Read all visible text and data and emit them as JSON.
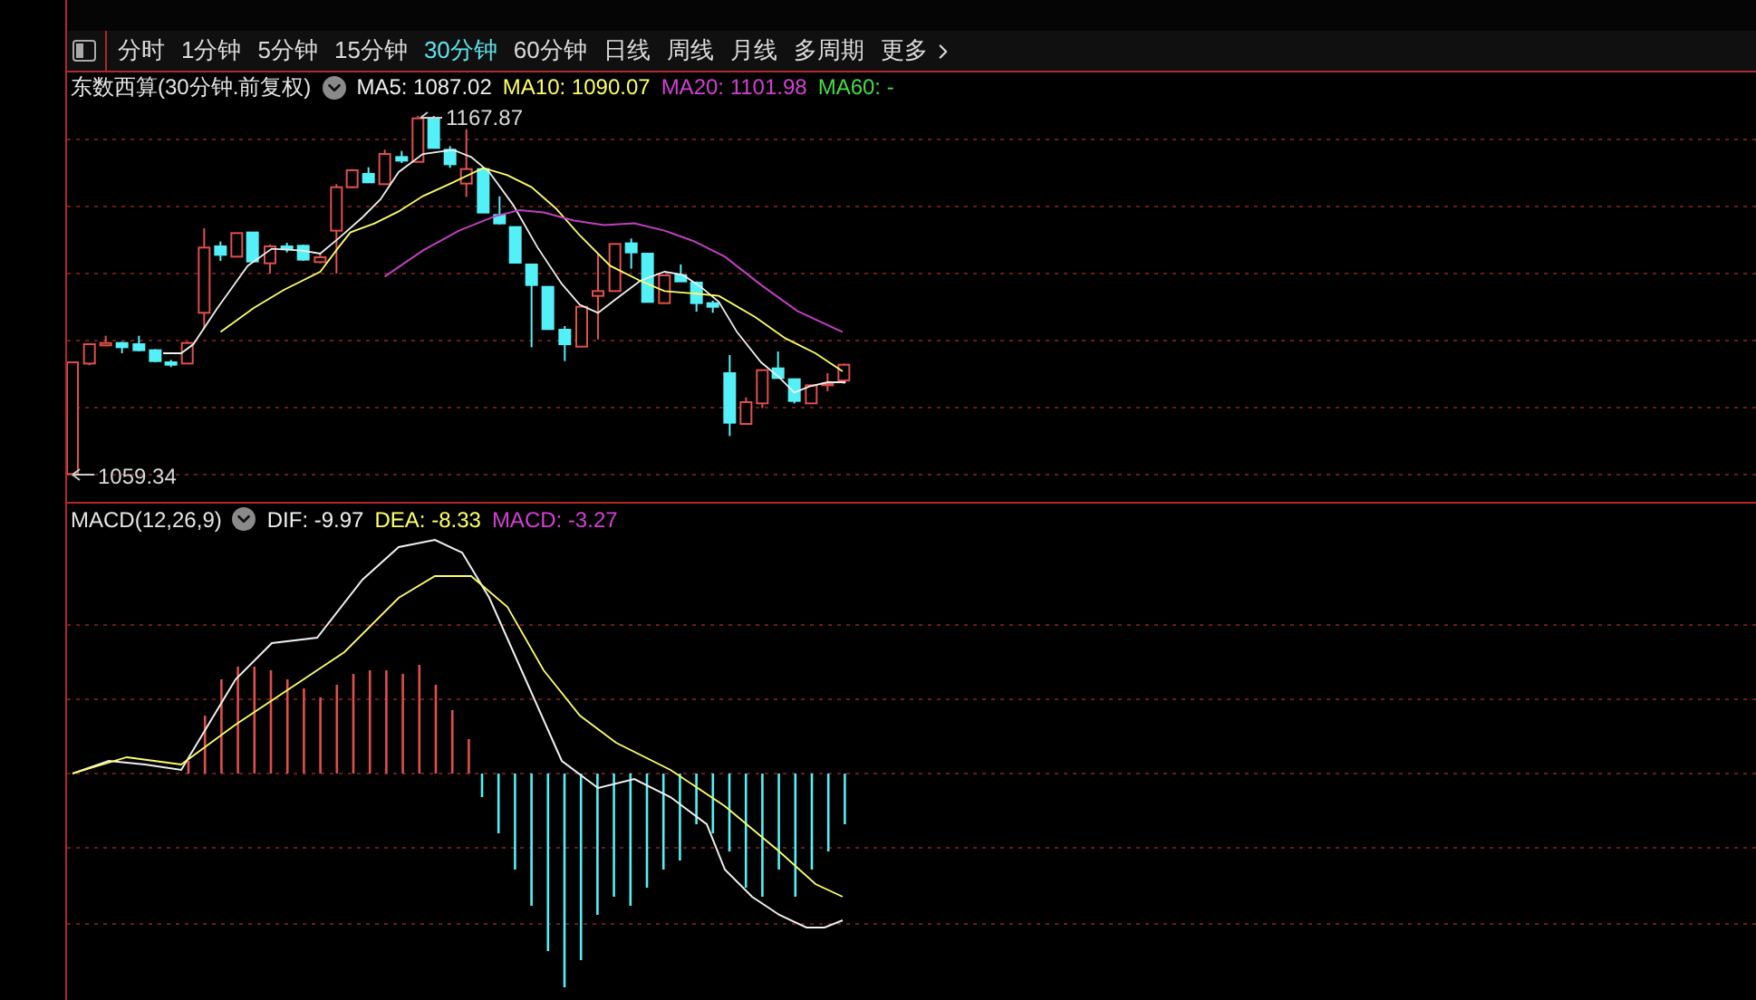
{
  "toolbar": {
    "tabs": [
      {
        "label": "分时",
        "selected": false
      },
      {
        "label": "1分钟",
        "selected": false
      },
      {
        "label": "5分钟",
        "selected": false
      },
      {
        "label": "15分钟",
        "selected": false
      },
      {
        "label": "30分钟",
        "selected": true
      },
      {
        "label": "60分钟",
        "selected": false
      },
      {
        "label": "日线",
        "selected": false
      },
      {
        "label": "周线",
        "selected": false
      },
      {
        "label": "月线",
        "selected": false
      },
      {
        "label": "多周期",
        "selected": false
      }
    ],
    "more": "更多"
  },
  "price_panel": {
    "title": "东数西算(30分钟.前复权)",
    "indicators": [
      {
        "text": "MA5: 1087.02",
        "color": "#f0f0f0"
      },
      {
        "text": "MA10: 1090.07",
        "color": "#ffff66"
      },
      {
        "text": "MA20: 1101.98",
        "color": "#d440d4"
      },
      {
        "text": "MA60: -",
        "color": "#44dd44"
      }
    ],
    "high_label": "1167.87",
    "low_label": "1059.34"
  },
  "macd_panel": {
    "title": "MACD(12,26,9)",
    "indicators": [
      {
        "text": "DIF: -9.97",
        "color": "#f0f0f0"
      },
      {
        "text": "DEA: -8.33",
        "color": "#ffff66"
      },
      {
        "text": "MACD: -3.27",
        "color": "#d440d4"
      }
    ]
  }
}
